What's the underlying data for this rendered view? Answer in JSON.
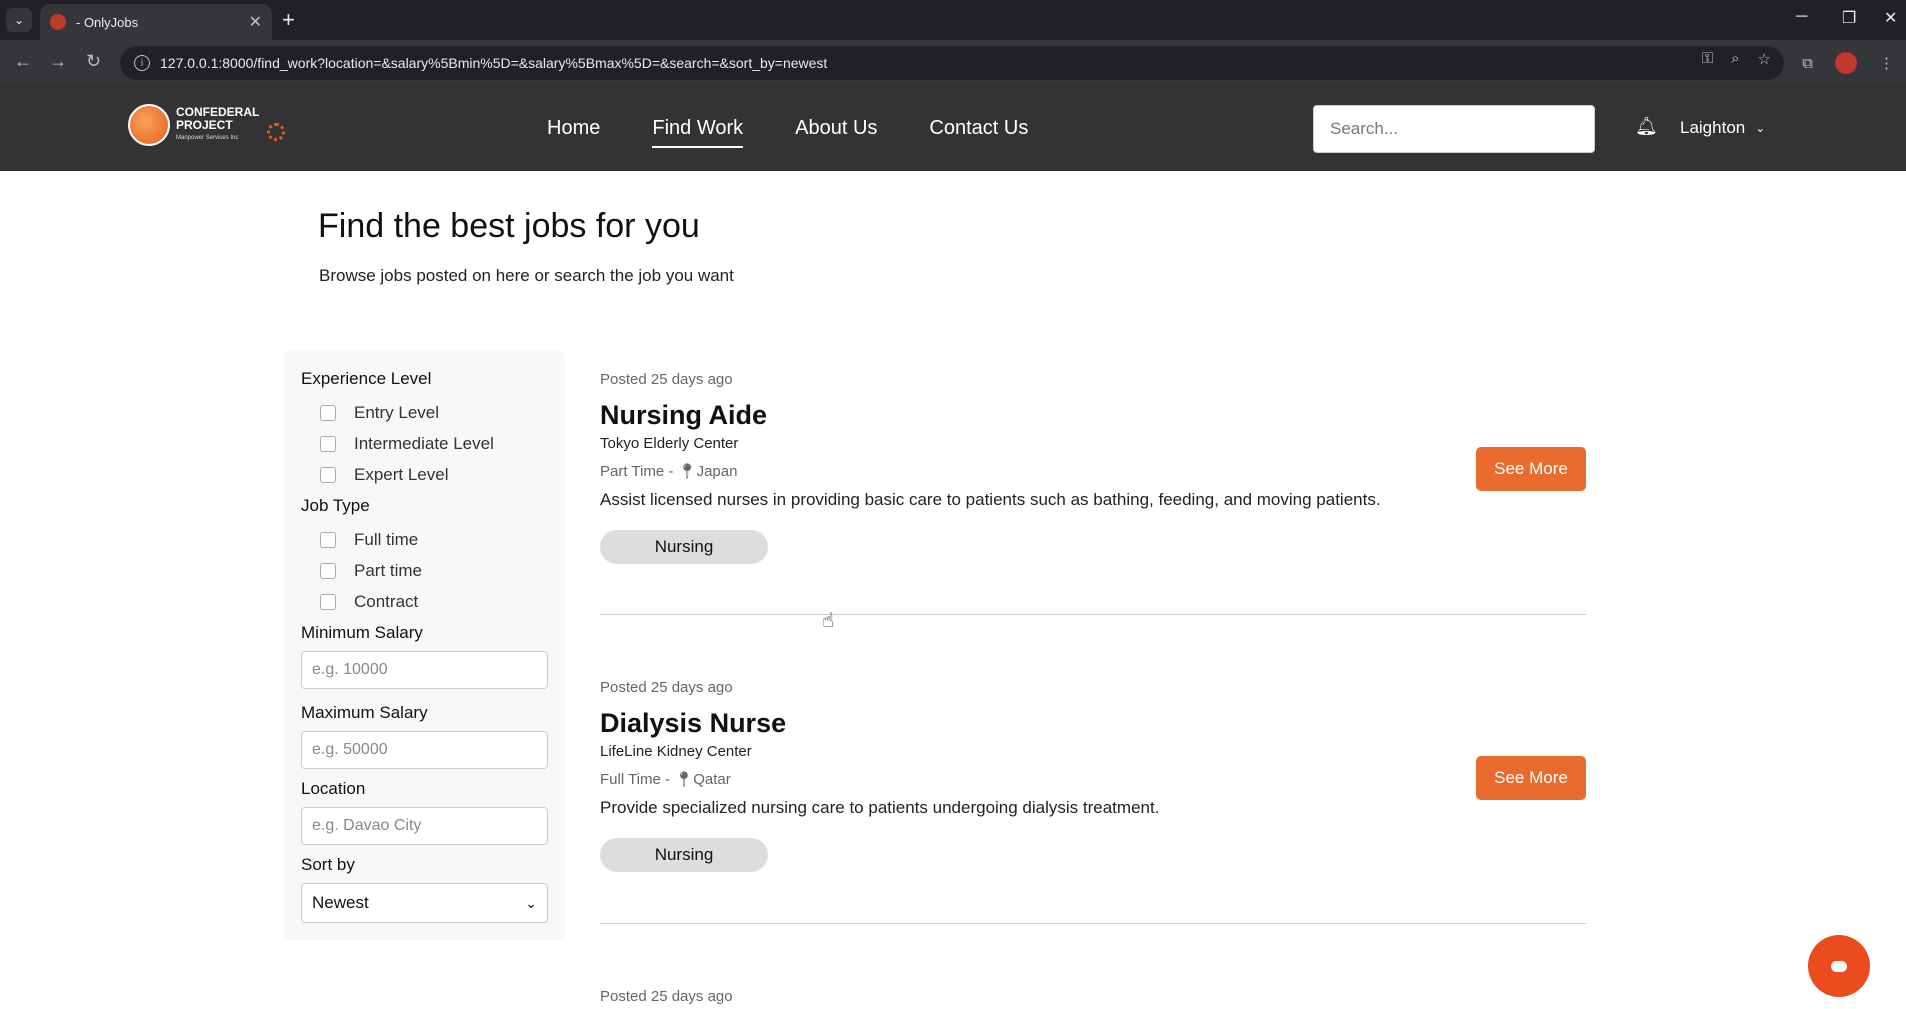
{
  "browser": {
    "tab_title": "- OnlyJobs",
    "url": "127.0.0.1:8000/find_work?location=&salary%5Bmin%5D=&salary%5Bmax%5D=&search=&sort_by=newest"
  },
  "header": {
    "logo_line1": "CONFEDERAL",
    "logo_line2": "PROJECT",
    "logo_sub": "Manpower Services Inc",
    "nav": [
      {
        "label": "Home"
      },
      {
        "label": "Find Work"
      },
      {
        "label": "About Us"
      },
      {
        "label": "Contact Us"
      }
    ],
    "search_placeholder": "Search...",
    "user_name": "Laighton"
  },
  "hero": {
    "title": "Find the best jobs for you",
    "subtitle": "Browse jobs posted on here or search the job you want"
  },
  "filters": {
    "experience_label": "Experience Level",
    "experience_options": [
      "Entry Level",
      "Intermediate Level",
      "Expert Level"
    ],
    "jobtype_label": "Job Type",
    "jobtype_options": [
      "Full time",
      "Part time",
      "Contract"
    ],
    "min_salary_label": "Minimum Salary",
    "min_salary_placeholder": "e.g. 10000",
    "max_salary_label": "Maximum Salary",
    "max_salary_placeholder": "e.g. 50000",
    "location_label": "Location",
    "location_placeholder": "e.g. Davao City",
    "sort_label": "Sort by",
    "sort_value": "Newest"
  },
  "jobs": [
    {
      "posted": "Posted 25 days ago",
      "title": "Nursing Aide",
      "company": "Tokyo Elderly Center",
      "type": "Part Time -",
      "location": "Japan",
      "description": "Assist licensed nurses in providing basic care to patients such as bathing, feeding, and moving patients.",
      "tag": "Nursing",
      "button": "See More"
    },
    {
      "posted": "Posted 25 days ago",
      "title": "Dialysis Nurse",
      "company": "LifeLine Kidney Center",
      "type": "Full Time -",
      "location": "Qatar",
      "description": "Provide specialized nursing care to patients undergoing dialysis treatment.",
      "tag": "Nursing",
      "button": "See More"
    },
    {
      "posted": "Posted 25 days ago"
    }
  ]
}
